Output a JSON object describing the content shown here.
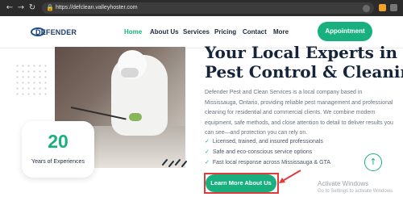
{
  "browser": {
    "url": "https://defclean.valleyhoster.com",
    "icons": [
      "back-arrow-icon",
      "forward-arrow-icon",
      "reload-icon",
      "lock-icon",
      "star-icon",
      "extension-icon",
      "profile-icon"
    ]
  },
  "header": {
    "logo_text": "DEFENDER",
    "nav": [
      "Home",
      "About Us",
      "Services",
      "Pricing",
      "Contact",
      "More"
    ],
    "active_nav": "Home",
    "cta_label": "Appointment"
  },
  "hero": {
    "title_line1": "Your Local Experts in",
    "title_line2": "Pest Control & Cleaning",
    "description": "Defender Pest and Clean Services is a local company based in Mississauga, Ontario, providing reliable pest management and professional cleaning for residential and commercial clients. We combine modern equipment, safe methods, and close attention to detail to deliver results you can see—and protection you can rely on.",
    "features": [
      "Licensed, trained, and insured professionals",
      "Safe and eco-conscious service options",
      "Fast local response across Mississauga & GTA"
    ],
    "button_label": "Learn More About Us",
    "stat_number": "20",
    "stat_label": "Years of Experiences"
  },
  "overlay": {
    "activate_title": "Activate Windows",
    "activate_sub": "Go to Settings to activate Windows."
  },
  "colors": {
    "accent": "#19b07f",
    "heading": "#15243a",
    "highlight": "#e23a3a"
  }
}
